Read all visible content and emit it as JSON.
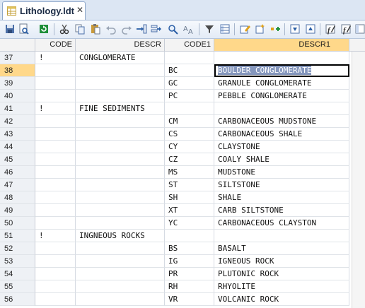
{
  "tab": {
    "label": "Lithology.ldt",
    "close": "✕"
  },
  "toolbar": {
    "buttons": [
      "save-icon",
      "print-preview-icon",
      "refresh-icon",
      "cut-icon",
      "copy-icon",
      "paste-icon",
      "undo-icon",
      "redo-icon",
      "insert-row-icon",
      "append-row-icon",
      "find-icon",
      "replace-icon",
      "filter-icon",
      "grid-view-icon",
      "edit-record-icon",
      "new-record-icon",
      "insert-field-icon",
      "move-down-icon",
      "move-up-icon",
      "edit-columns-icon",
      "column-properties-icon"
    ]
  },
  "columns": {
    "code": "CODE",
    "descr": "DESCR",
    "code1": "CODE1",
    "descr1": "DESCR1"
  },
  "rows": [
    {
      "n": "37",
      "code": "!",
      "descr": "CONGLOMERATE",
      "code1": "",
      "descr1": ""
    },
    {
      "n": "38",
      "code": "",
      "descr": "",
      "code1": "BC",
      "descr1": "BOULDER CONGLOMERATE"
    },
    {
      "n": "39",
      "code": "",
      "descr": "",
      "code1": "GC",
      "descr1": "GRANULE CONGLOMERATE"
    },
    {
      "n": "40",
      "code": "",
      "descr": "",
      "code1": "PC",
      "descr1": "PEBBLE CONGLOMERATE"
    },
    {
      "n": "41",
      "code": "!",
      "descr": "FINE SEDIMENTS",
      "code1": "",
      "descr1": ""
    },
    {
      "n": "42",
      "code": "",
      "descr": "",
      "code1": "CM",
      "descr1": "CARBONACEOUS MUDSTONE"
    },
    {
      "n": "43",
      "code": "",
      "descr": "",
      "code1": "CS",
      "descr1": "CARBONACEOUS SHALE"
    },
    {
      "n": "44",
      "code": "",
      "descr": "",
      "code1": "CY",
      "descr1": "CLAYSTONE"
    },
    {
      "n": "45",
      "code": "",
      "descr": "",
      "code1": "CZ",
      "descr1": "COALY SHALE"
    },
    {
      "n": "46",
      "code": "",
      "descr": "",
      "code1": "MS",
      "descr1": "MUDSTONE"
    },
    {
      "n": "47",
      "code": "",
      "descr": "",
      "code1": "ST",
      "descr1": "SILTSTONE"
    },
    {
      "n": "48",
      "code": "",
      "descr": "",
      "code1": "SH",
      "descr1": "SHALE"
    },
    {
      "n": "49",
      "code": "",
      "descr": "",
      "code1": "XT",
      "descr1": "CARB SILTSTONE"
    },
    {
      "n": "50",
      "code": "",
      "descr": "",
      "code1": "YC",
      "descr1": "CARBONACEOUS CLAYSTON"
    },
    {
      "n": "51",
      "code": "!",
      "descr": "INGNEOUS ROCKS",
      "code1": "",
      "descr1": ""
    },
    {
      "n": "52",
      "code": "",
      "descr": "",
      "code1": "BS",
      "descr1": "BASALT"
    },
    {
      "n": "53",
      "code": "",
      "descr": "",
      "code1": "IG",
      "descr1": "IGNEOUS ROCK"
    },
    {
      "n": "54",
      "code": "",
      "descr": "",
      "code1": "PR",
      "descr1": "PLUTONIC ROCK"
    },
    {
      "n": "55",
      "code": "",
      "descr": "",
      "code1": "RH",
      "descr1": "RHYOLITE"
    },
    {
      "n": "56",
      "code": "",
      "descr": "",
      "code1": "VR",
      "descr1": "VOLCANIC ROCK"
    }
  ],
  "selected_row": "38",
  "selected_column": "DESCR1",
  "colors": {
    "selected_header": "#ffd88a",
    "selection_fill": "#8597bd",
    "tabbar": "#dce6f3"
  }
}
